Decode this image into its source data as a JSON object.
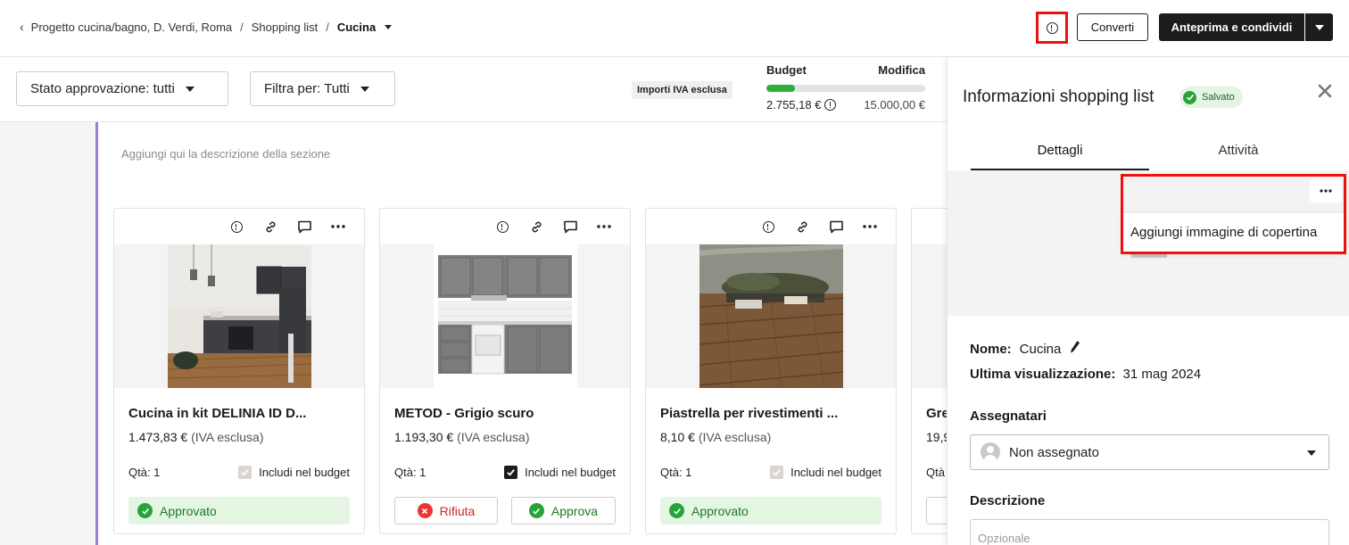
{
  "breadcrumb": {
    "items": [
      "Progetto cucina/bagno, D. Verdi, Roma",
      "Shopping list"
    ],
    "current": "Cucina"
  },
  "header": {
    "info_icon": "info-circle-icon",
    "convert_label": "Converti",
    "preview_label": "Anteprima e condividi"
  },
  "filters": {
    "approval_status": "Stato approvazione: tutti",
    "filter_by": "Filtra per: Tutti"
  },
  "budget": {
    "vat_badge": "Importi IVA esclusa",
    "label": "Budget",
    "edit_label": "Modifica",
    "spent": "2.755,18 €",
    "limit": "15.000,00 €",
    "progress_fraction": 0.18,
    "progress_color": "#2fae3c"
  },
  "section": {
    "description_placeholder": "Aggiungi qui la descrizione della sezione"
  },
  "cards": [
    {
      "title": "Cucina in kit DELINIA ID D...",
      "price": "1.473,83 €",
      "vat_note": "(IVA esclusa)",
      "qty": "Qtà: 1",
      "budget_label": "Includi nel budget",
      "status": "Approvato"
    },
    {
      "title": "METOD - Grigio scuro",
      "price": "1.193,30 €",
      "vat_note": "(IVA esclusa)",
      "qty": "Qtà: 1",
      "budget_label": "Includi nel budget",
      "reject_label": "Rifiuta",
      "approve_label": "Approva"
    },
    {
      "title": "Piastrella per rivestimenti ...",
      "price": "8,10 €",
      "vat_note": "(IVA esclusa)",
      "qty": "Qtà: 1",
      "budget_label": "Includi nel budget",
      "status": "Approvato"
    },
    {
      "title": "Gre",
      "price": "19,9",
      "qty": "Qtà"
    }
  ],
  "panel": {
    "title": "Informazioni shopping list",
    "saved_badge": "Salvato",
    "tabs": [
      "Dettagli",
      "Attività"
    ],
    "cover_menu_item": "Aggiungi immagine di copertina",
    "name_label": "Nome:",
    "name_value": "Cucina",
    "last_view_label": "Ultima visualizzazione:",
    "last_view_value": "31 mag 2024",
    "assignees_label": "Assegnatari",
    "assignee_value": "Non assegnato",
    "description_label": "Descrizione",
    "description_placeholder": "Opzionale"
  },
  "colors": {
    "accent_dark": "#1c1c1c",
    "approved_bg": "#e4f6e2",
    "approved_text": "#1d7a26",
    "reject_text": "#c62828",
    "highlight_red": "#e11111",
    "section_line": "#9b7fd6"
  }
}
